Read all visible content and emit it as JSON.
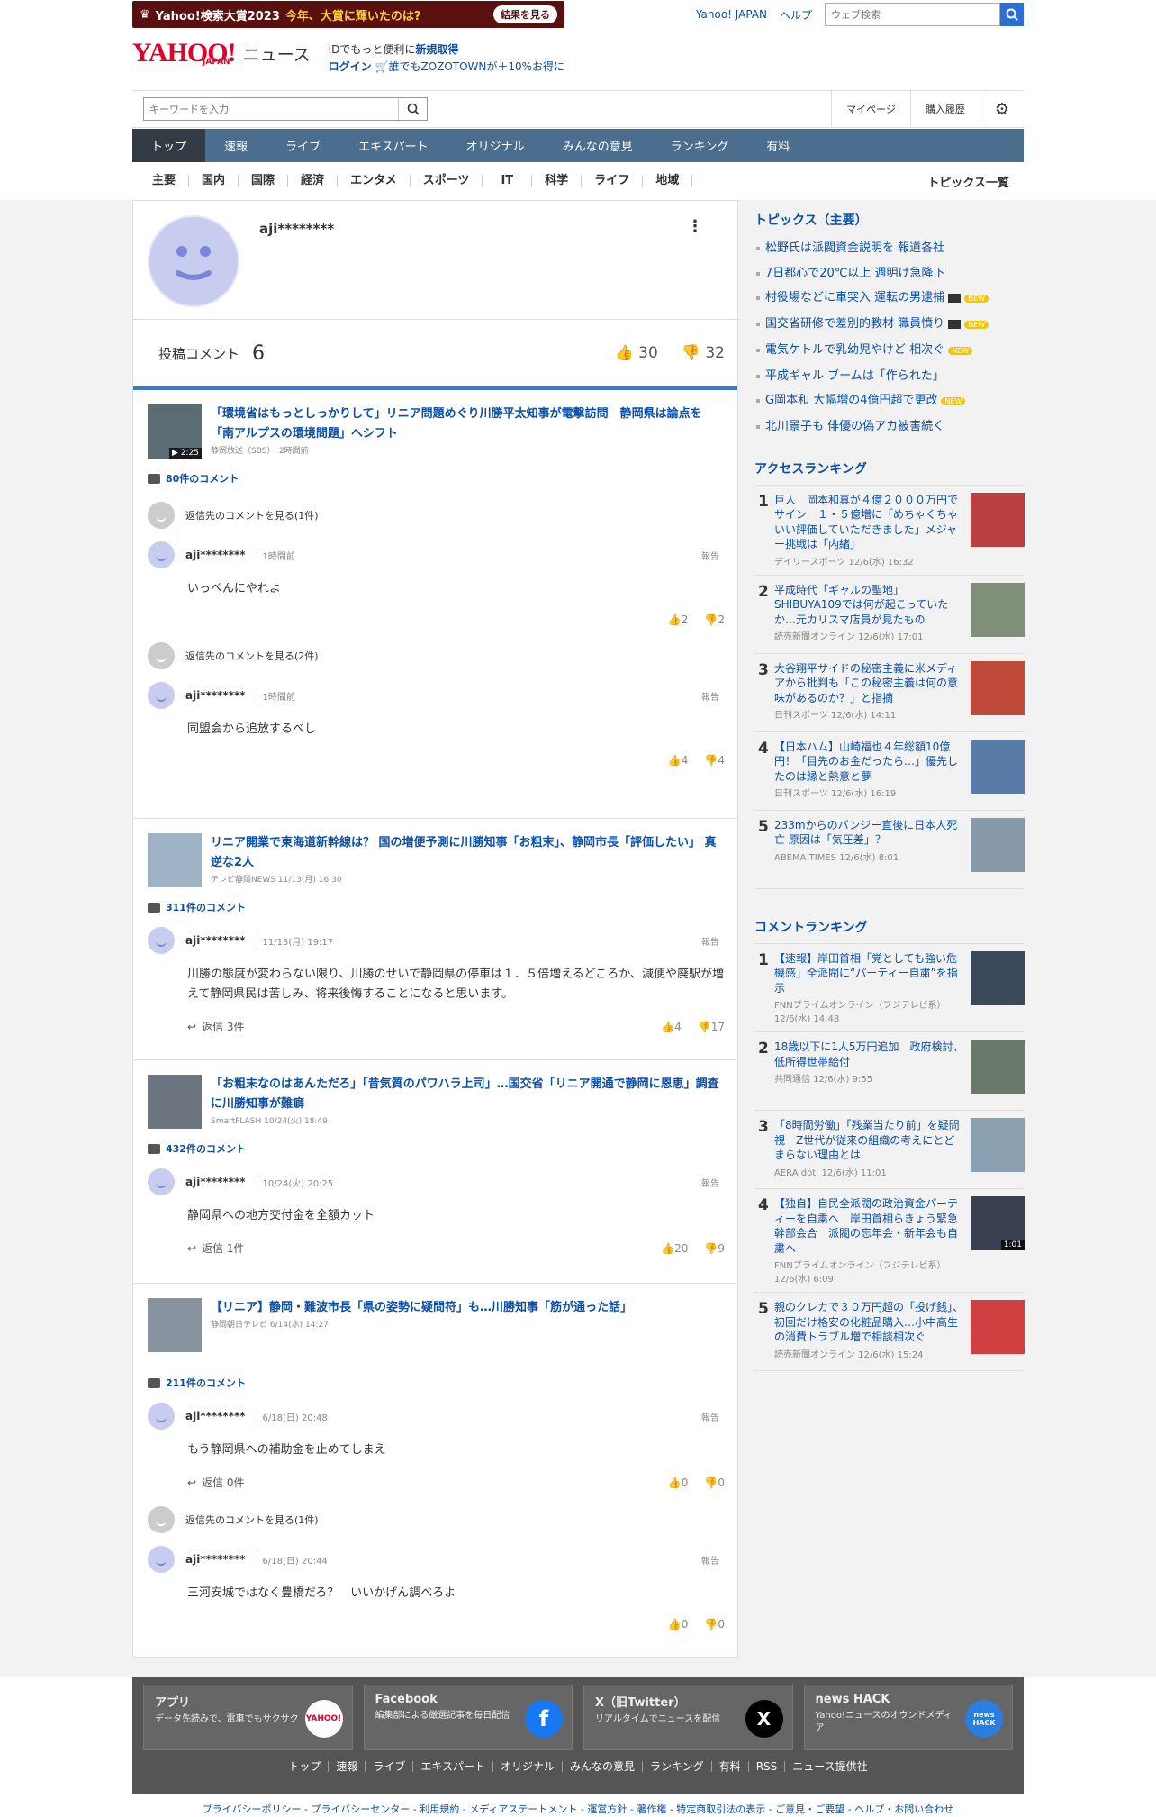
{
  "header": {
    "promo_prefix": "Yahoo!検索大賞2023",
    "promo_highlight": "今年、大賞に輝いたのは?",
    "promo_button": "結果を見る",
    "yahoo_japan": "Yahoo! JAPAN",
    "help": "ヘルプ",
    "web_search_placeholder": "ウェブ検索",
    "logo_text": "YAHOO!",
    "logo_sub": "JAPAN",
    "logo_news": "ニュース",
    "id_line1_pre": "IDでもっと便利に",
    "id_line1_link": "新規取得",
    "login": "ログイン",
    "zozo": "誰でもZOZOTOWNが＋10%お得に",
    "keyword_placeholder": "キーワードを入力",
    "mypage": "マイページ",
    "purchase": "購入履歴"
  },
  "nav": [
    "トップ",
    "速報",
    "ライブ",
    "エキスパート",
    "オリジナル",
    "みんなの意見",
    "ランキング",
    "有料"
  ],
  "subnav": [
    "主要",
    "国内",
    "国際",
    "経済",
    "エンタメ",
    "スポーツ",
    "IT",
    "科学",
    "ライフ",
    "地域"
  ],
  "subnav_all": "トピックス一覧",
  "profile": {
    "name": "aji********",
    "stats_label": "投稿コメント",
    "count": "6",
    "likes": "30",
    "dislikes": "32"
  },
  "threads": [
    {
      "title": "「環境省はもっとしっかりして」リニア問題めぐり川勝平太知事が電撃訪問　静岡県は論点を「南アルプスの環境問題」へシフト",
      "source": "静岡放送（SBS）　2時間前",
      "duration": "2:25",
      "comments": "80件のコメント",
      "items": [
        {
          "parent": "返信先のコメントを見る(1件)",
          "user": "aji********",
          "time": "1時間前",
          "report": "報告",
          "body": "いっぺんにやれよ",
          "reply": "",
          "like": "2",
          "dislike": "2"
        },
        {
          "parent": "返信先のコメントを見る(2件)",
          "user": "aji********",
          "time": "1時間前",
          "report": "報告",
          "body": "同盟会から追放するべし",
          "reply": "",
          "like": "4",
          "dislike": "4"
        }
      ]
    },
    {
      "title": "リニア開業で東海道新幹線は？ 国の増便予測に川勝知事「お粗末」、静岡市長「評価したい」 真逆な2人",
      "source": "テレビ静岡NEWS 11/13(月) 16:30",
      "duration": "",
      "comments": "311件のコメント",
      "items": [
        {
          "parent": "",
          "user": "aji********",
          "time": "11/13(月) 19:17",
          "report": "報告",
          "body": "川勝の態度が変わらない限り、川勝のせいで静岡県の停車は１．５倍増えるどころか、減便や廃駅が増えて静岡県民は苦しみ、将来後悔することになると思います。",
          "reply": "返信 3件",
          "like": "4",
          "dislike": "17"
        }
      ]
    },
    {
      "title": "「お粗末なのはあんただろ」「昔気質のパワハラ上司」…国交省「リニア開通で静岡に恩恵」調査に川勝知事が難癖",
      "source": "SmartFLASH 10/24(火) 18:49",
      "duration": "",
      "comments": "432件のコメント",
      "items": [
        {
          "parent": "",
          "user": "aji********",
          "time": "10/24(火) 20:25",
          "report": "報告",
          "body": "静岡県への地方交付金を全額カット",
          "reply": "返信 1件",
          "like": "20",
          "dislike": "9"
        }
      ]
    },
    {
      "title": "【リニア】静岡・難波市長「県の姿勢に疑問符」も…川勝知事「筋が通った話」",
      "source": "静岡朝日テレビ 6/14(水) 14:27",
      "duration": "",
      "comments": "211件のコメント",
      "items": [
        {
          "parent": "",
          "user": "aji********",
          "time": "6/18(日) 20:48",
          "report": "報告",
          "body": "もう静岡県への補助金を止めてしまえ",
          "reply": "返信 0件",
          "like": "0",
          "dislike": "0"
        },
        {
          "parent": "返信先のコメントを見る(1件)",
          "user": "aji********",
          "time": "6/18(日) 20:44",
          "report": "報告",
          "body": "三河安城ではなく豊橋だろ？　いいかげん調べろよ",
          "reply": "",
          "like": "0",
          "dislike": "0"
        }
      ]
    }
  ],
  "topics_title": "トピックス（主要）",
  "topics": [
    {
      "text": "松野氏は派閥資金説明を 報道各社",
      "video": false,
      "new": false
    },
    {
      "text": "7日都心で20℃以上 週明け急降下",
      "video": false,
      "new": false
    },
    {
      "text": "村役場などに車突入 運転の男逮捕",
      "video": true,
      "new": true
    },
    {
      "text": "国交省研修で差別的教材 職員憤り",
      "video": true,
      "new": true
    },
    {
      "text": "電気ケトルで乳幼児やけど 相次ぐ",
      "video": false,
      "new": true
    },
    {
      "text": "平成ギャル ブームは「作られた」",
      "video": false,
      "new": false
    },
    {
      "text": "G岡本和 大幅増の4億円超で更改",
      "video": false,
      "new": true
    },
    {
      "text": "北川景子も 俳優の偽アカ被害続く",
      "video": false,
      "new": false
    }
  ],
  "new_badge": "NEW",
  "access_title": "アクセスランキング",
  "access": [
    {
      "no": "1",
      "title": "巨人　岡本和真が４億２０００万円でサイン　１・５億増に「めちゃくちゃいい評価していただきました」メジャー挑戦は「内緒」",
      "source": "デイリースポーツ 12/6(水) 16:32"
    },
    {
      "no": "2",
      "title": "平成時代「ギャルの聖地」SHIBUYA109では何が起こっていたか…元カリスマ店員が見たもの",
      "source": "読売新聞オンライン 12/6(水) 17:01"
    },
    {
      "no": "3",
      "title": "大谷翔平サイドの秘密主義に米メディアから批判も「この秘密主義は何の意味があるのか？」と指摘",
      "source": "日刊スポーツ 12/6(水) 14:11"
    },
    {
      "no": "4",
      "title": "【日本ハム】山崎福也４年総額10億円！「目先のお金だったら…」優先したのは縁と熱意と夢",
      "source": "日刊スポーツ 12/6(水) 16:19"
    },
    {
      "no": "5",
      "title": "233mからのバンジー直後に日本人死亡 原因は「気圧差」？",
      "source": "ABEMA TIMES 12/6(水) 8:01"
    }
  ],
  "comment_rank_title": "コメントランキング",
  "comment_rank": [
    {
      "no": "1",
      "title": "【速報】岸田首相「党としても強い危機感」全派閥に“パーティー自粛”を指示",
      "source": "FNNプライムオンライン（フジテレビ系） 12/6(水) 14:48"
    },
    {
      "no": "2",
      "title": "18歳以下に1人5万円追加　政府検討、低所得世帯給付",
      "source": "共同通信 12/6(水) 9:55"
    },
    {
      "no": "3",
      "title": "「8時間労働」「残業当たり前」を疑問視　Z世代が従来の組織の考えにとどまらない理由とは",
      "source": "AERA dot. 12/6(水) 11:01"
    },
    {
      "no": "4",
      "title": "【独自】自民全派閥の政治資金パーティーを自粛へ　岸田首相らきょう緊急幹部会合　派閥の忘年会・新年会も自粛へ",
      "source": "FNNプライムオンライン（フジテレビ系） 12/6(水) 6:09",
      "duration": "1:01"
    },
    {
      "no": "5",
      "title": "親のクレカで３０万円超の「投げ銭」、初回だけ格安の化粧品購入…小中高生の消費トラブル増で相談相次ぐ",
      "source": "読売新聞オンライン 12/6(水) 15:24"
    }
  ],
  "footer": {
    "apps": [
      {
        "title": "アプリ",
        "desc": "データ先読みで、電車でもサクサク",
        "logo": "YAHOO!",
        "color": "#ffffff"
      },
      {
        "title": "Facebook",
        "desc": "編集部による厳選記事を毎日配信",
        "logo": "f",
        "color": "#1877f2"
      },
      {
        "title": "X（旧Twitter）",
        "desc": "リアルタイムでニュースを配信",
        "logo": "X",
        "color": "#000000"
      },
      {
        "title": "news HACK",
        "desc": "Yahoo!ニュースのオウンドメディア",
        "logo": "news HACK",
        "color": "#2a7de1"
      }
    ],
    "links": [
      "トップ",
      "速報",
      "ライブ",
      "エキスパート",
      "オリジナル",
      "みんなの意見",
      "ランキング",
      "有料",
      "RSS",
      "ニュース提供社"
    ],
    "legal": "プライバシーポリシー - プライバシーセンター - 利用規約 - メディアステートメント - 運営方針 - 著作権 - 特定商取引法の表示 - ご意見・ご要望 - ヘルプ・お問い合わせ"
  }
}
